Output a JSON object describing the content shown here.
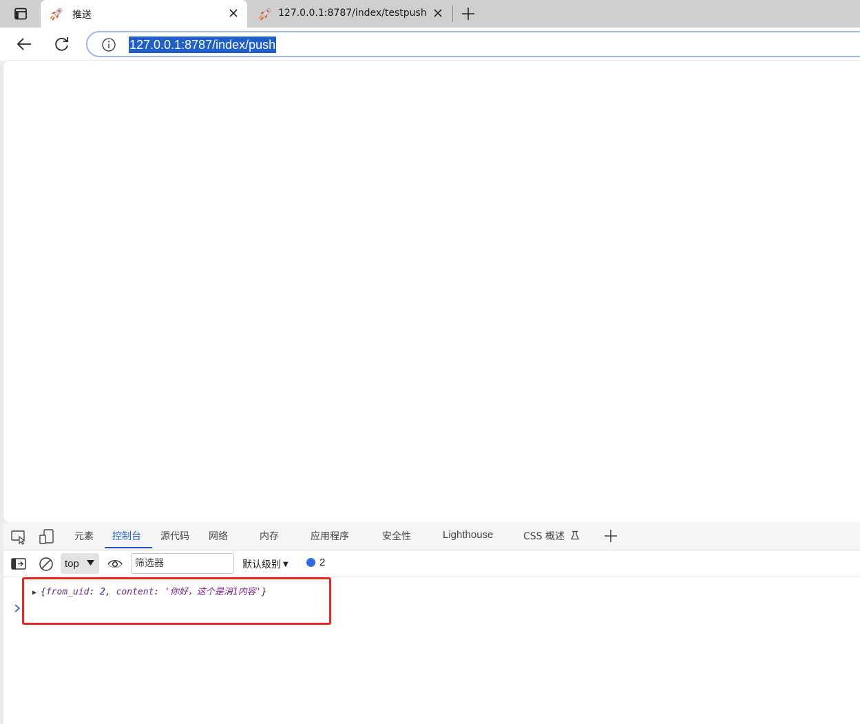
{
  "tabs": [
    {
      "title": "推送",
      "active": true
    },
    {
      "title": "127.0.0.1:8787/index/testpush",
      "active": false
    }
  ],
  "address_bar": {
    "url": "127.0.0.1:8787/index/push"
  },
  "devtools": {
    "tabs": [
      "元素",
      "控制台",
      "源代码",
      "网络",
      "内存",
      "应用程序",
      "安全性",
      "Lighthouse",
      "CSS 概述"
    ],
    "active_tab": "控制台",
    "context": "top",
    "filter_placeholder": "筛选器",
    "levels_label": "默认级别",
    "message_count": "2",
    "console_log": {
      "open": "{",
      "k1": "from_uid",
      "v1": "2",
      "sep": ", ",
      "k2": "content",
      "v2": "'你好，这个是消1内容'",
      "close": "}"
    }
  },
  "colors": {
    "accent": "#1f58c2",
    "url_selection": "#1f5fcc",
    "highlight_box": "#e5251e"
  }
}
